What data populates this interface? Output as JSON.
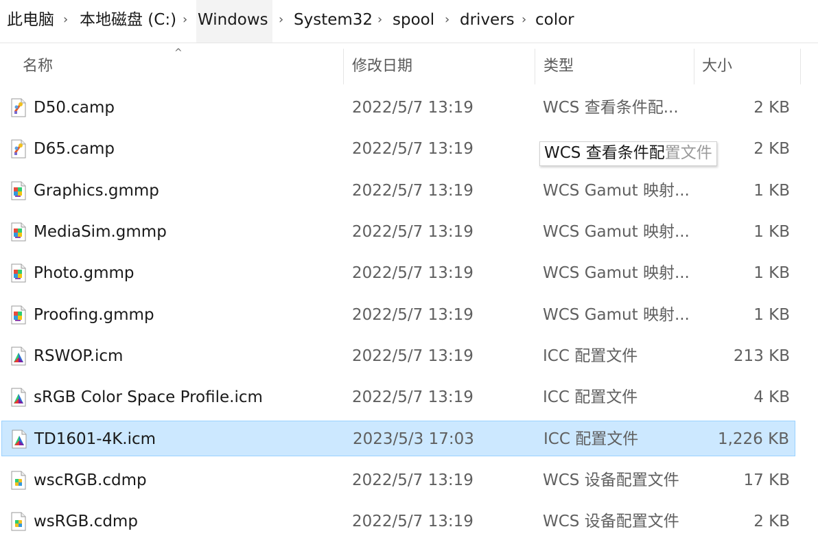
{
  "breadcrumb": {
    "items": [
      "此电脑",
      "本地磁盘 (C:)",
      "Windows",
      "System32",
      "spool",
      "drivers",
      "color"
    ],
    "separator": "›"
  },
  "columns": {
    "name": "名称",
    "date": "修改日期",
    "type": "类型",
    "size": "大小",
    "sort_indicator": "^"
  },
  "files": [
    {
      "name": "D50.camp",
      "date": "2022/5/7 13:19",
      "type": "WCS 查看条件配...",
      "size": "2 KB",
      "icon": "camp-file-icon"
    },
    {
      "name": "D65.camp",
      "date": "2022/5/7 13:19",
      "type": "WCS 查看条件配",
      "size": "2 KB",
      "icon": "camp-file-icon"
    },
    {
      "name": "Graphics.gmmp",
      "date": "2022/5/7 13:19",
      "type": "WCS Gamut 映射...",
      "size": "1 KB",
      "icon": "gmmp-file-icon"
    },
    {
      "name": "MediaSim.gmmp",
      "date": "2022/5/7 13:19",
      "type": "WCS Gamut 映射...",
      "size": "1 KB",
      "icon": "gmmp-file-icon"
    },
    {
      "name": "Photo.gmmp",
      "date": "2022/5/7 13:19",
      "type": "WCS Gamut 映射...",
      "size": "1 KB",
      "icon": "gmmp-file-icon"
    },
    {
      "name": "Proofing.gmmp",
      "date": "2022/5/7 13:19",
      "type": "WCS Gamut 映射...",
      "size": "1 KB",
      "icon": "gmmp-file-icon"
    },
    {
      "name": "RSWOP.icm",
      "date": "2022/5/7 13:19",
      "type": "ICC 配置文件",
      "size": "213 KB",
      "icon": "icm-file-icon"
    },
    {
      "name": "sRGB Color Space Profile.icm",
      "date": "2022/5/7 13:19",
      "type": "ICC 配置文件",
      "size": "4 KB",
      "icon": "icm-file-icon"
    },
    {
      "name": "TD1601-4K.icm",
      "date": "2023/5/3 17:03",
      "type": "ICC 配置文件",
      "size": "1,226 KB",
      "icon": "icm-file-icon",
      "selected": true
    },
    {
      "name": "wscRGB.cdmp",
      "date": "2022/5/7 13:19",
      "type": "WCS 设备配置文件",
      "size": "17 KB",
      "icon": "cdmp-file-icon"
    },
    {
      "name": "wsRGB.cdmp",
      "date": "2022/5/7 13:19",
      "type": "WCS 设备配置文件",
      "size": "2 KB",
      "icon": "cdmp-file-icon"
    }
  ],
  "tooltip": {
    "text_visible": "WCS 查看条件配",
    "text_faded": "置文件"
  },
  "colors": {
    "selection_bg": "#cce8ff",
    "selection_border": "#99d1ff",
    "breadcrumb_highlight": "#f3f3f3"
  }
}
